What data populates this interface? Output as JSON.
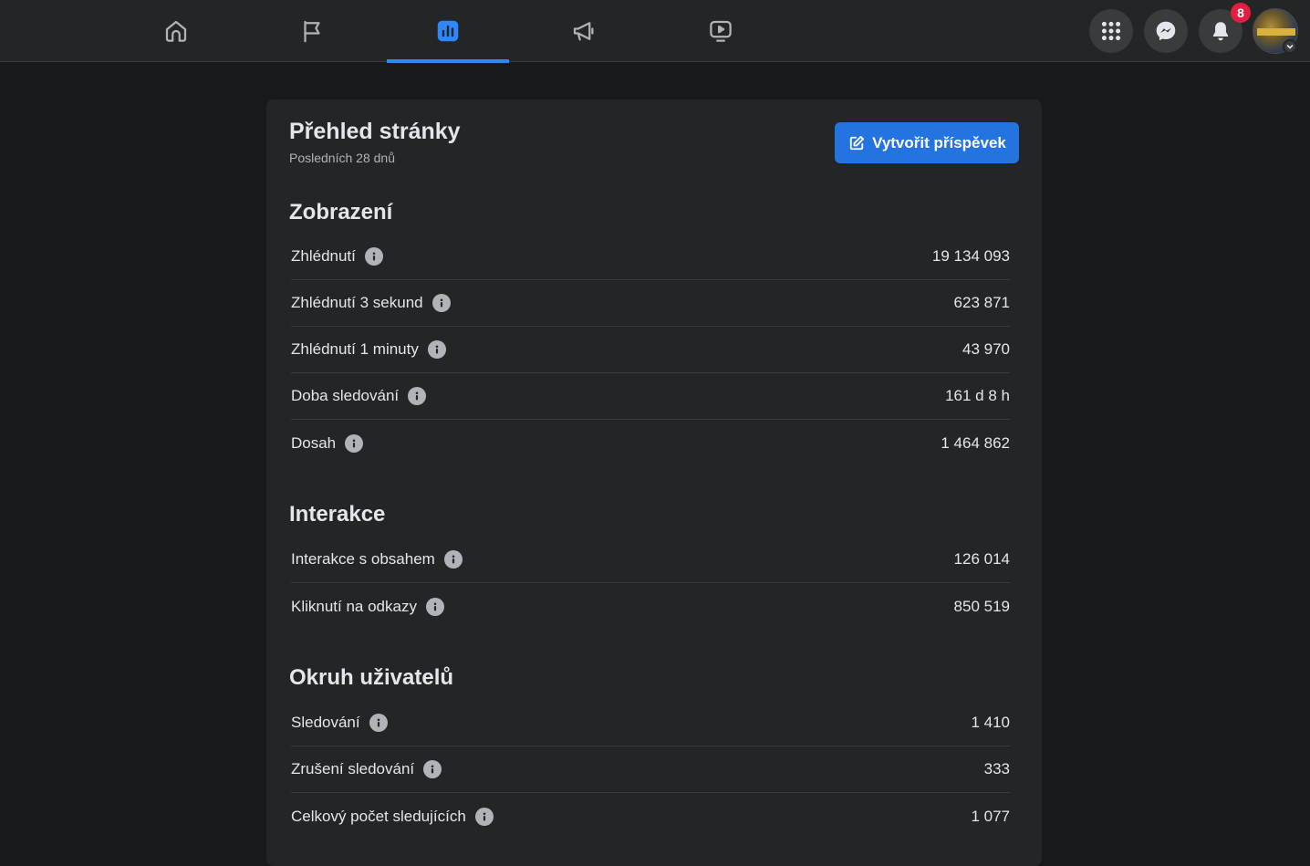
{
  "nav": {
    "tabs": [
      {
        "name": "home-icon",
        "active": false
      },
      {
        "name": "flag-icon",
        "active": false
      },
      {
        "name": "insights-icon",
        "active": true
      },
      {
        "name": "megaphone-icon",
        "active": false
      },
      {
        "name": "watch-icon",
        "active": false
      }
    ],
    "accent": "#2d88ff",
    "notifications_count": "8"
  },
  "overview": {
    "title": "Přehled stránky",
    "subtitle": "Posledních 28 dnů",
    "create_post_label": "Vytvořit příspěvek"
  },
  "sections": [
    {
      "title": "Zobrazení",
      "metrics": [
        {
          "label": "Zhlédnutí",
          "value": "19 134 093"
        },
        {
          "label": "Zhlédnutí 3 sekund",
          "value": "623 871"
        },
        {
          "label": "Zhlédnutí 1 minuty",
          "value": "43 970"
        },
        {
          "label": "Doba sledování",
          "value": "161 d 8 h"
        },
        {
          "label": "Dosah",
          "value": "1 464 862"
        }
      ]
    },
    {
      "title": "Interakce",
      "metrics": [
        {
          "label": "Interakce s obsahem",
          "value": "126 014"
        },
        {
          "label": "Kliknutí na odkazy",
          "value": "850 519"
        }
      ]
    },
    {
      "title": "Okruh uživatelů",
      "metrics": [
        {
          "label": "Sledování",
          "value": "1 410"
        },
        {
          "label": "Zrušení sledování",
          "value": "333"
        },
        {
          "label": "Celkový počet sledujících",
          "value": "1 077"
        }
      ]
    }
  ]
}
